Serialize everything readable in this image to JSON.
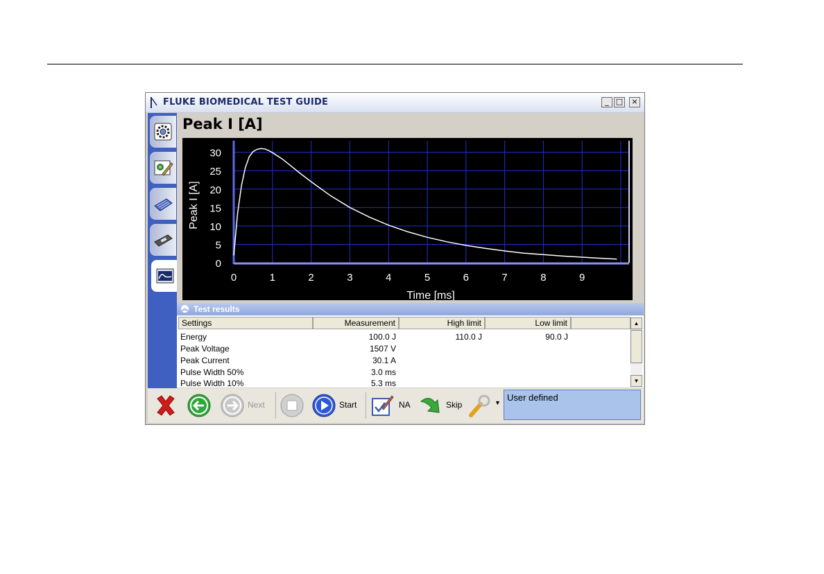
{
  "window": {
    "title": "FLUKE BIOMEDICAL TEST GUIDE"
  },
  "sidebar": {
    "tabs": [
      {
        "icon": "gear-eye-icon"
      },
      {
        "icon": "edit-pencil-icon"
      },
      {
        "icon": "keyboard-icon"
      },
      {
        "icon": "device-icon"
      },
      {
        "icon": "waveform-icon"
      }
    ]
  },
  "main": {
    "title": "Peak I [A]"
  },
  "chart_data": {
    "type": "line",
    "title": "",
    "xlabel": "Time [ms]",
    "ylabel": "Peak I [A]",
    "xlim": [
      0,
      10
    ],
    "ylim": [
      0,
      32
    ],
    "xticks": [
      "0",
      "1",
      "2",
      "3",
      "4",
      "5",
      "6",
      "7",
      "8",
      "9"
    ],
    "yticks": [
      "0",
      "5",
      "10",
      "15",
      "20",
      "25",
      "30"
    ],
    "grid": true,
    "colors": {
      "background": "#000000",
      "grid": "#1f2fd0",
      "line": "#ffffff",
      "text": "#ffffff"
    },
    "series": [
      {
        "x": [
          0,
          0.1,
          0.2,
          0.3,
          0.4,
          0.5,
          0.6,
          0.7,
          0.8,
          0.9,
          1.0,
          1.25,
          1.5,
          1.75,
          2.0,
          2.5,
          3.0,
          3.5,
          4.0,
          4.5,
          5.0,
          5.5,
          6.0,
          6.5,
          7.0,
          7.5,
          8.0,
          8.5,
          9.0,
          9.5,
          9.9
        ],
        "y": [
          2.0,
          13.5,
          21.0,
          25.8,
          28.8,
          30.2,
          30.8,
          31.0,
          30.9,
          30.5,
          29.9,
          28.2,
          26.1,
          24.0,
          22.0,
          18.2,
          15.0,
          12.4,
          10.2,
          8.4,
          6.9,
          5.7,
          4.7,
          3.9,
          3.2,
          2.6,
          2.2,
          1.8,
          1.5,
          1.2,
          1.0
        ]
      }
    ]
  },
  "results": {
    "header": "Test results",
    "columns": [
      "Settings",
      "Measurement",
      "High limit",
      "Low limit"
    ],
    "rows": [
      {
        "setting": "Energy",
        "measurement": "100.0 J",
        "high": "110.0 J",
        "low": "90.0 J"
      },
      {
        "setting": "Peak Voltage",
        "measurement": "1507 V",
        "high": "",
        "low": ""
      },
      {
        "setting": "Peak Current",
        "measurement": "30.1 A",
        "high": "",
        "low": ""
      },
      {
        "setting": "Pulse Width 50%",
        "measurement": "3.0 ms",
        "high": "",
        "low": ""
      },
      {
        "setting": "Pulse Width 10%",
        "measurement": "5.3 ms",
        "high": "",
        "low": ""
      }
    ]
  },
  "toolbar": {
    "next_label": "Next",
    "start_label": "Start",
    "na_label": "NA",
    "skip_label": "Skip",
    "status": "User defined"
  }
}
